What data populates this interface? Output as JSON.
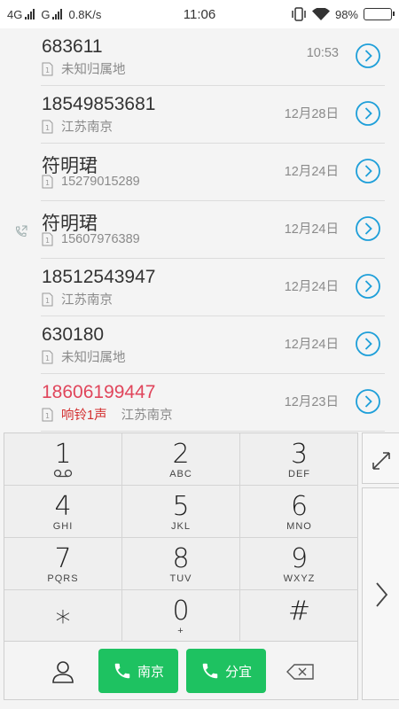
{
  "status_bar": {
    "network1": "4G",
    "network2": "G",
    "speed": "0.8K/s",
    "time": "11:06",
    "battery": "98%",
    "battery_level": 0.98
  },
  "call_log": [
    {
      "name": "683611",
      "sim_label": "1",
      "location": "未知归属地",
      "time": "10:53",
      "missed": false
    },
    {
      "name": "18549853681",
      "sim_label": "1",
      "location": "江苏南京",
      "time": "12月28日",
      "missed": false
    },
    {
      "name": "符明珺",
      "sim_label": "1",
      "location": "15279015289",
      "time": "12月24日",
      "missed": false
    },
    {
      "name": "符明珺",
      "sim_label": "1",
      "location": "15607976389",
      "time": "12月24日",
      "missed": false,
      "call_type_icon": "outgoing-call-icon"
    },
    {
      "name": "18512543947",
      "sim_label": "1",
      "location": "江苏南京",
      "time": "12月24日",
      "missed": false
    },
    {
      "name": "630180",
      "sim_label": "1",
      "location": "未知归属地",
      "time": "12月24日",
      "missed": false
    },
    {
      "name": "18606199447",
      "sim_label": "1",
      "ring_info": "响铃1声",
      "location": "江苏南京",
      "time": "12月23日",
      "missed": true
    }
  ],
  "keypad": [
    {
      "digit": "1",
      "letters": ""
    },
    {
      "digit": "2",
      "letters": "ABC"
    },
    {
      "digit": "3",
      "letters": "DEF"
    },
    {
      "digit": "4",
      "letters": "GHI"
    },
    {
      "digit": "5",
      "letters": "JKL"
    },
    {
      "digit": "6",
      "letters": "MNO"
    },
    {
      "digit": "7",
      "letters": "PQRS"
    },
    {
      "digit": "8",
      "letters": "TUV"
    },
    {
      "digit": "9",
      "letters": "WXYZ"
    },
    {
      "digit": "*",
      "letters": ""
    },
    {
      "digit": "0",
      "letters": "+"
    },
    {
      "digit": "#",
      "letters": ""
    }
  ],
  "actions": {
    "call_sim1_label": "南京",
    "call_sim2_label": "分宜"
  },
  "colors": {
    "accent": "#1e9fd9",
    "call_green": "#1ec261",
    "missed_red": "#e0455b",
    "ring_red": "#d32f2f"
  }
}
